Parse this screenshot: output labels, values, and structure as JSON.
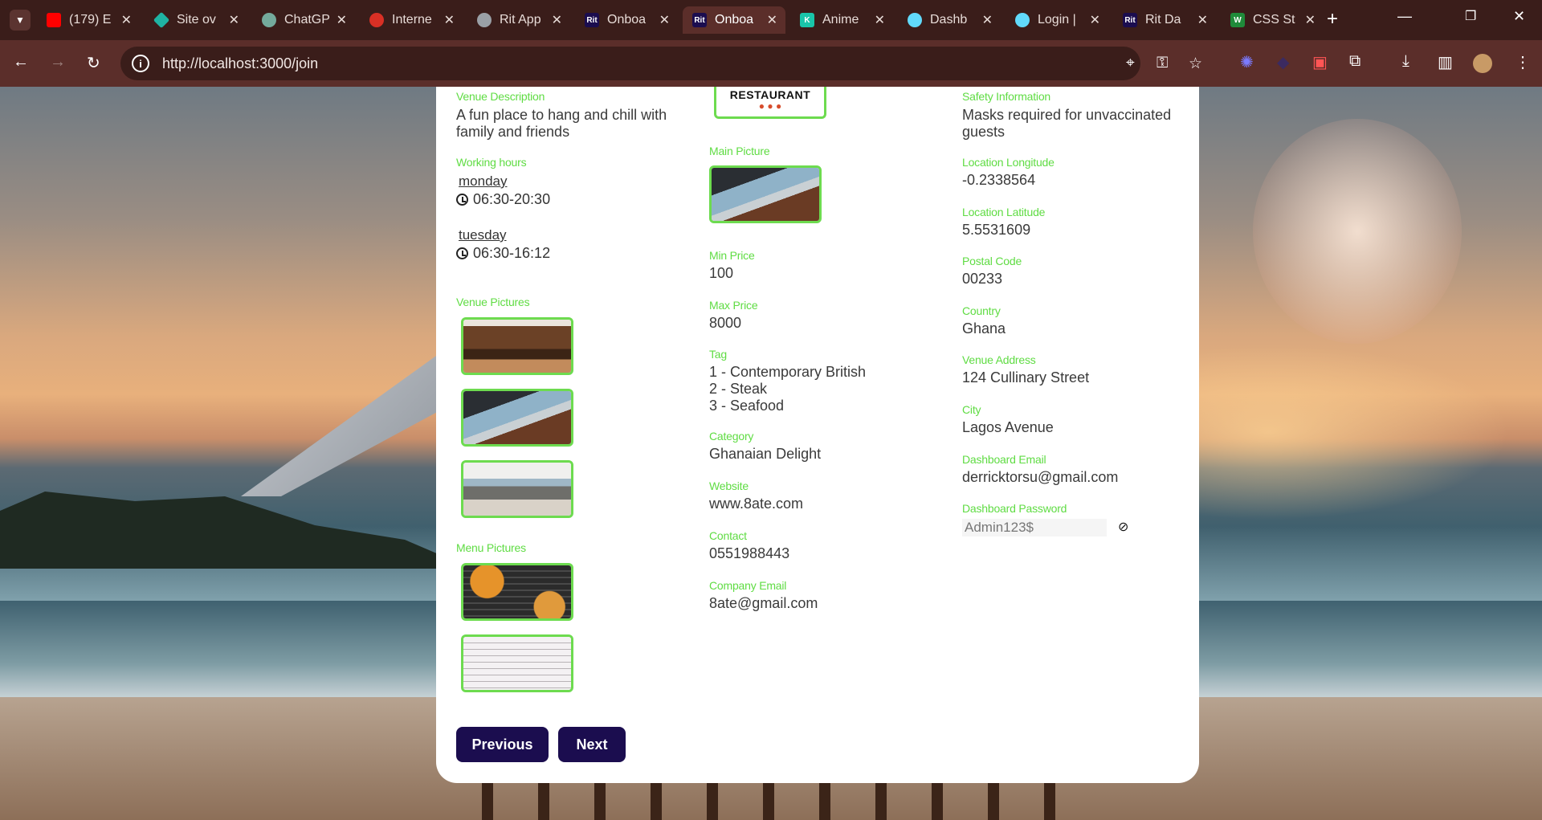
{
  "browser": {
    "tabs": [
      {
        "title": "(179) E",
        "favicon": "youtube-icon",
        "color": "#ff0000"
      },
      {
        "title": "Site ov",
        "favicon": "diamond-icon",
        "color": "#1fb3a3"
      },
      {
        "title": "ChatGP",
        "favicon": "chatgpt-icon",
        "color": "#74aa9c"
      },
      {
        "title": "Interne",
        "favicon": "speedometer-icon",
        "color": "#d93025"
      },
      {
        "title": "Rit App",
        "favicon": "globe-icon",
        "color": "#9aa0a6"
      },
      {
        "title": "Onboa",
        "favicon": "rit-icon",
        "color": "#1b0d4f"
      },
      {
        "title": "Onboa",
        "favicon": "rit-icon",
        "color": "#1b0d4f"
      },
      {
        "title": "Anime",
        "favicon": "k-icon",
        "color": "#19c5a9"
      },
      {
        "title": "Dashb",
        "favicon": "react-icon",
        "color": "#61dafb"
      },
      {
        "title": "Login |",
        "favicon": "react-icon",
        "color": "#61dafb"
      },
      {
        "title": "Rit Da",
        "favicon": "rit-icon",
        "color": "#1b0d4f"
      },
      {
        "title": "CSS St",
        "favicon": "w-icon",
        "color": "#1f8b3a"
      }
    ],
    "active_tab_index": 6,
    "url": "http://localhost:3000/join",
    "rit_favicon_text": "Rit",
    "k_favicon_text": "K",
    "w_favicon_text": "W"
  },
  "form": {
    "col1": {
      "venue_description_label": "Venue Description",
      "venue_description": "A fun place to hang and chill with family and friends",
      "working_hours_label": "Working hours",
      "hours": [
        {
          "day": "monday",
          "time": "06:30-20:30"
        },
        {
          "day": "tuesday",
          "time": "06:30-16:12"
        }
      ],
      "venue_pictures_label": "Venue Pictures",
      "menu_pictures_label": "Menu Pictures"
    },
    "col2": {
      "logo_text": "RESTAURANT",
      "main_picture_label": "Main Picture",
      "min_price_label": "Min Price",
      "min_price": "100",
      "max_price_label": "Max Price",
      "max_price": "8000",
      "tag_label": "Tag",
      "tags": [
        "1 - Contemporary British",
        "2 - Steak",
        "3 - Seafood"
      ],
      "category_label": "Category",
      "category": "Ghanaian Delight",
      "website_label": "Website",
      "website": "www.8ate.com",
      "contact_label": "Contact",
      "contact": "0551988443",
      "company_email_label": "Company Email",
      "company_email": "8ate@gmail.com"
    },
    "col3": {
      "safety_label": "Safety Information",
      "safety": "Masks required for unvaccinated guests",
      "longitude_label": "Location Longitude",
      "longitude": "-0.2338564",
      "latitude_label": "Location Latitude",
      "latitude": "5.5531609",
      "postal_label": "Postal Code",
      "postal": "00233",
      "country_label": "Country",
      "country": "Ghana",
      "address_label": "Venue Address",
      "address": "124 Cullinary Street",
      "city_label": "City",
      "city": "Lagos Avenue",
      "dash_email_label": "Dashboard Email",
      "dash_email": "derricktorsu@gmail.com",
      "dash_password_label": "Dashboard Password",
      "dash_password": "Admin123$"
    },
    "buttons": {
      "previous": "Previous",
      "next": "Next"
    }
  },
  "colors": {
    "label_green": "#5fdc43",
    "button_navy": "#1b0d4f",
    "chrome_dark": "#3a1d1a",
    "chrome_bar": "#5b2e2a"
  }
}
